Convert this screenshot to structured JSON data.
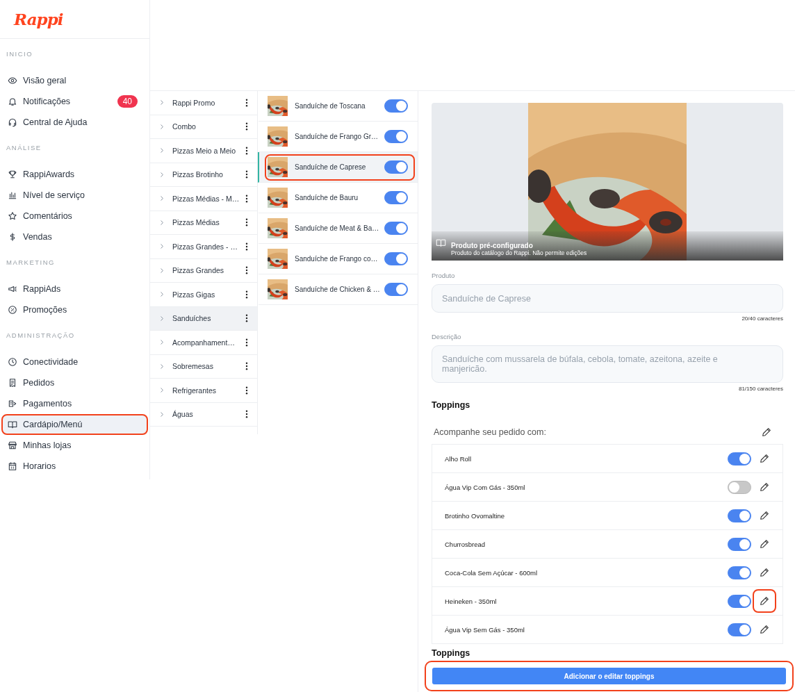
{
  "logo": "Rappi",
  "sidebar": {
    "sections": [
      {
        "title": "INICIO",
        "items": [
          {
            "label": "Visão geral",
            "selected": false,
            "highlighted": false
          },
          {
            "label": "Notificações",
            "badge": "40",
            "selected": false,
            "highlighted": false
          },
          {
            "label": "Central de Ajuda",
            "selected": false,
            "highlighted": false
          }
        ]
      },
      {
        "title": "ANÁLISE",
        "items": [
          {
            "label": "RappiAwards",
            "selected": false,
            "highlighted": false
          },
          {
            "label": "Nível de serviço",
            "selected": false,
            "highlighted": false
          },
          {
            "label": "Comentários",
            "selected": false,
            "highlighted": false
          },
          {
            "label": "Vendas",
            "selected": false,
            "highlighted": false
          }
        ]
      },
      {
        "title": "MARKETING",
        "items": [
          {
            "label": "RappiAds",
            "selected": false,
            "highlighted": false
          },
          {
            "label": "Promoções",
            "selected": false,
            "highlighted": false
          }
        ]
      },
      {
        "title": "ADMINISTRAÇÃO",
        "items": [
          {
            "label": "Conectividade",
            "selected": false,
            "highlighted": false
          },
          {
            "label": "Pedidos",
            "selected": false,
            "highlighted": false
          },
          {
            "label": "Pagamentos",
            "selected": false,
            "highlighted": false
          },
          {
            "label": "Cardápio/Menú",
            "selected": true,
            "highlighted": true
          },
          {
            "label": "Minhas lojas",
            "selected": false,
            "highlighted": false
          },
          {
            "label": "Horarios",
            "selected": false,
            "highlighted": false
          }
        ]
      }
    ]
  },
  "categories": [
    {
      "name": "Rappi Promo",
      "selected": false
    },
    {
      "name": "Combo",
      "selected": false
    },
    {
      "name": "Pizzas Meio a Meio",
      "selected": false
    },
    {
      "name": "Pizzas Brotinho",
      "selected": false
    },
    {
      "name": "Pizzas Médias - M…",
      "selected": false
    },
    {
      "name": "Pizzas Médias",
      "selected": false
    },
    {
      "name": "Pizzas Grandes - …",
      "selected": false
    },
    {
      "name": "Pizzas Grandes",
      "selected": false
    },
    {
      "name": "Pizzas Gigas",
      "selected": false
    },
    {
      "name": "Sanduíches",
      "selected": true
    },
    {
      "name": "Acompanhament…",
      "selected": false
    },
    {
      "name": "Sobremesas",
      "selected": false
    },
    {
      "name": "Refrigerantes",
      "selected": false
    },
    {
      "name": "Águas",
      "selected": false
    }
  ],
  "products": [
    {
      "name": "Sanduíche de Toscana",
      "on": true,
      "selected": false,
      "highlighted": false
    },
    {
      "name": "Sanduíche de Frango Gr…",
      "on": true,
      "selected": false,
      "highlighted": false
    },
    {
      "name": "Sanduíche de Caprese",
      "on": true,
      "selected": true,
      "highlighted": true
    },
    {
      "name": "Sanduíche de Bauru",
      "on": true,
      "selected": false,
      "highlighted": false
    },
    {
      "name": "Sanduíche de Meat & Ba…",
      "on": true,
      "selected": false,
      "highlighted": false
    },
    {
      "name": "Sanduíche de Frango co…",
      "on": true,
      "selected": false,
      "highlighted": false
    },
    {
      "name": "Sanduíche de Chicken & …",
      "on": true,
      "selected": false,
      "highlighted": false
    }
  ],
  "detail": {
    "caption_title": "Produto pré-configurado",
    "caption_text": "Produto do catálogo do Rappi. Não permite edições",
    "product_label": "Produto",
    "product_value": "Sanduíche de Caprese",
    "product_count": "20/40 caracteres",
    "description_label": "Descrição",
    "description_value": "Sanduíche com mussarela de búfala, cebola, tomate, azeitona, azeite e manjericão.",
    "description_count": "81/150 caracteres"
  },
  "toppings": {
    "heading": "Toppings",
    "group_title": "Acompanhe seu pedido com:",
    "items": [
      {
        "name": "Alho Roll",
        "on": true,
        "highlighted": false
      },
      {
        "name": "Água Vip Com Gás - 350ml",
        "on": false,
        "highlighted": false
      },
      {
        "name": "Brotinho Ovomaltine",
        "on": true,
        "highlighted": false
      },
      {
        "name": "Churrosbread",
        "on": true,
        "highlighted": false
      },
      {
        "name": "Coca-Cola Sem Açúcar - 600ml",
        "on": true,
        "highlighted": false
      },
      {
        "name": "Heineken - 350ml",
        "on": true,
        "highlighted": true
      },
      {
        "name": "Água Vip Sem Gás - 350ml",
        "on": true,
        "highlighted": false
      }
    ],
    "footer_heading": "Toppings",
    "button": {
      "label": "Adicionar o editar toppings",
      "highlighted": true
    }
  }
}
